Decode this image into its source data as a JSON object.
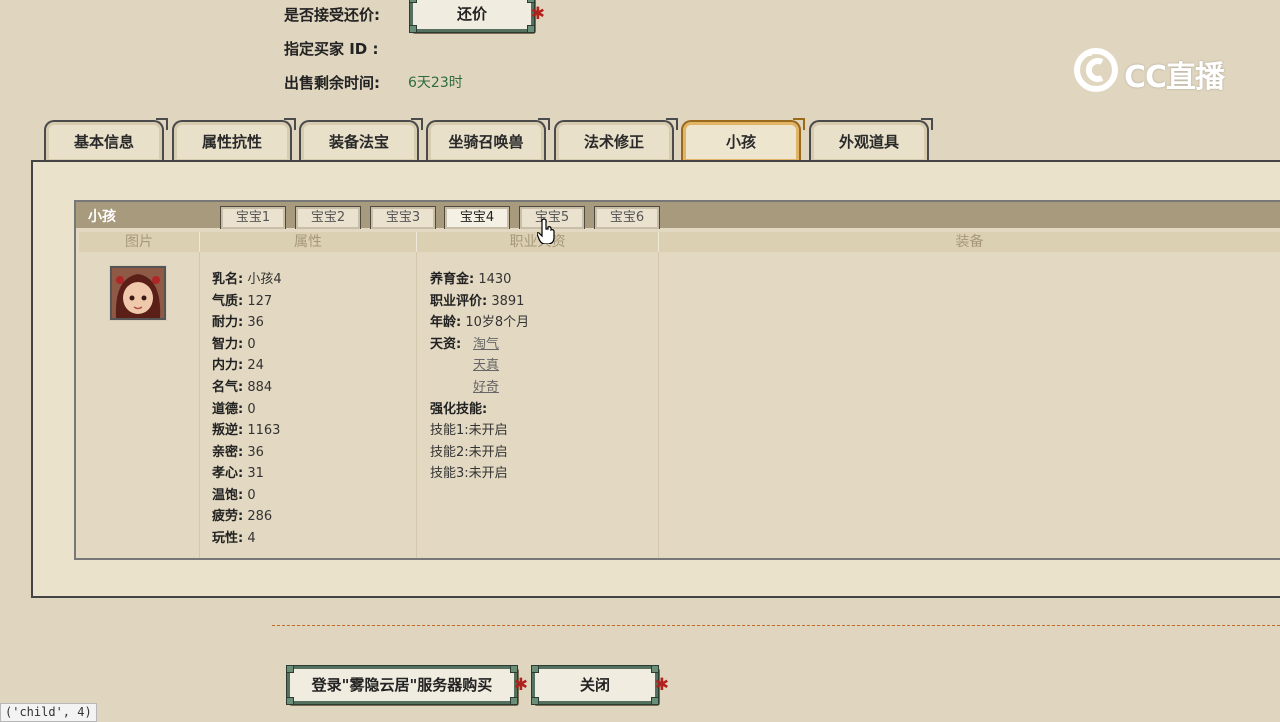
{
  "top": {
    "accept_counter_label": "是否接受还价:",
    "counter_button": "还价",
    "buyer_id_label": "指定买家 ID :",
    "time_left_label": "出售剩余时间:",
    "time_left_value": "6天23时"
  },
  "logo": {
    "text": "CC直播"
  },
  "tabs": [
    {
      "label": "基本信息"
    },
    {
      "label": "属性抗性"
    },
    {
      "label": "装备法宝"
    },
    {
      "label": "坐骑召唤兽"
    },
    {
      "label": "法术修正"
    },
    {
      "label": "小孩",
      "active": true
    },
    {
      "label": "外观道具"
    }
  ],
  "child_panel": {
    "title": "小孩",
    "subtabs": [
      {
        "label": "宝宝1"
      },
      {
        "label": "宝宝2"
      },
      {
        "label": "宝宝3"
      },
      {
        "label": "宝宝4",
        "active": true
      },
      {
        "label": "宝宝5"
      },
      {
        "label": "宝宝6"
      }
    ],
    "columns": [
      "图片",
      "属性",
      "职业天资",
      "装备"
    ],
    "attributes": [
      {
        "k": "乳名:",
        "v": "小孩4"
      },
      {
        "k": "气质:",
        "v": "127"
      },
      {
        "k": "耐力:",
        "v": "36"
      },
      {
        "k": "智力:",
        "v": "0"
      },
      {
        "k": "内力:",
        "v": "24"
      },
      {
        "k": "名气:",
        "v": "884"
      },
      {
        "k": "道德:",
        "v": "0"
      },
      {
        "k": "叛逆:",
        "v": "1163"
      },
      {
        "k": "亲密:",
        "v": "36"
      },
      {
        "k": "孝心:",
        "v": "31"
      },
      {
        "k": "温饱:",
        "v": "0"
      },
      {
        "k": "疲劳:",
        "v": "286"
      },
      {
        "k": "玩性:",
        "v": "4"
      }
    ],
    "career": {
      "raise_money": {
        "k": "养育金:",
        "v": "1430"
      },
      "career_score": {
        "k": "职业评价:",
        "v": "3891"
      },
      "age": {
        "k": "年龄:",
        "v": "10岁8个月"
      },
      "talent_label": "天资:",
      "talents": [
        "淘气",
        "天真",
        "好奇"
      ],
      "skills_label": "强化技能:",
      "skills": [
        {
          "k": "技能1:",
          "v": "未开启"
        },
        {
          "k": "技能2:",
          "v": "未开启"
        },
        {
          "k": "技能3:",
          "v": "未开启"
        }
      ]
    }
  },
  "bottom": {
    "login_buy_button": "登录\"雾隐云居\"服务器购买",
    "close_button": "关闭"
  },
  "status_text": "('child', 4)",
  "colors": {
    "background": "#e0d6c0",
    "accent_green": "#2f6b3c",
    "active_tab_border": "#9a6a1c",
    "knot_red": "#b0221c"
  }
}
